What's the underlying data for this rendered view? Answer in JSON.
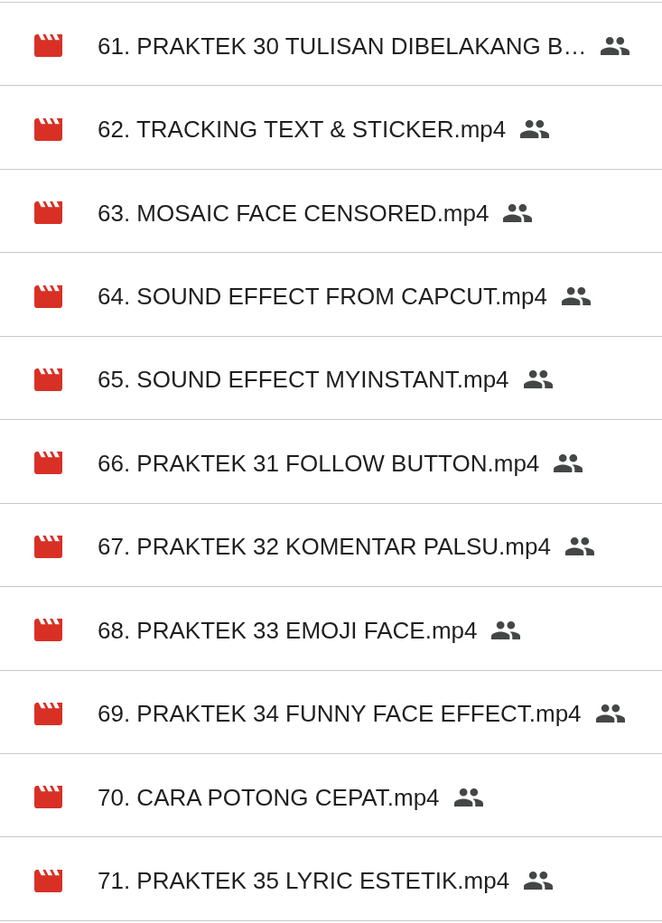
{
  "files": [
    {
      "name": "61. PRAKTEK 30 TULISAN DIBELAKANG B…",
      "shared": true
    },
    {
      "name": "62. TRACKING TEXT & STICKER.mp4",
      "shared": true
    },
    {
      "name": "63. MOSAIC FACE CENSORED.mp4",
      "shared": true
    },
    {
      "name": "64. SOUND EFFECT FROM CAPCUT.mp4",
      "shared": true
    },
    {
      "name": "65. SOUND EFFECT MYINSTANT.mp4",
      "shared": true
    },
    {
      "name": "66. PRAKTEK 31 FOLLOW BUTTON.mp4",
      "shared": true
    },
    {
      "name": "67. PRAKTEK 32 KOMENTAR PALSU.mp4",
      "shared": true
    },
    {
      "name": "68. PRAKTEK 33 EMOJI FACE.mp4",
      "shared": true
    },
    {
      "name": "69. PRAKTEK 34 FUNNY FACE EFFECT.mp4",
      "shared": true
    },
    {
      "name": "70. CARA POTONG CEPAT.mp4",
      "shared": true
    },
    {
      "name": "71. PRAKTEK 35 LYRIC ESTETIK.mp4",
      "shared": true
    }
  ]
}
